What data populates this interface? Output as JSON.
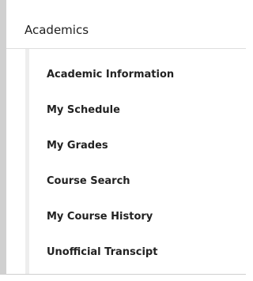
{
  "section": {
    "title": "Academics"
  },
  "menu": {
    "items": [
      {
        "label": "Academic Information"
      },
      {
        "label": "My Schedule"
      },
      {
        "label": "My Grades"
      },
      {
        "label": "Course Search"
      },
      {
        "label": "My Course History"
      },
      {
        "label": "Unofficial Transcipt"
      }
    ]
  },
  "colors": {
    "background": "#ffffff",
    "rail": "#d0d0d0",
    "text": "#222222",
    "border": "#dedede"
  }
}
